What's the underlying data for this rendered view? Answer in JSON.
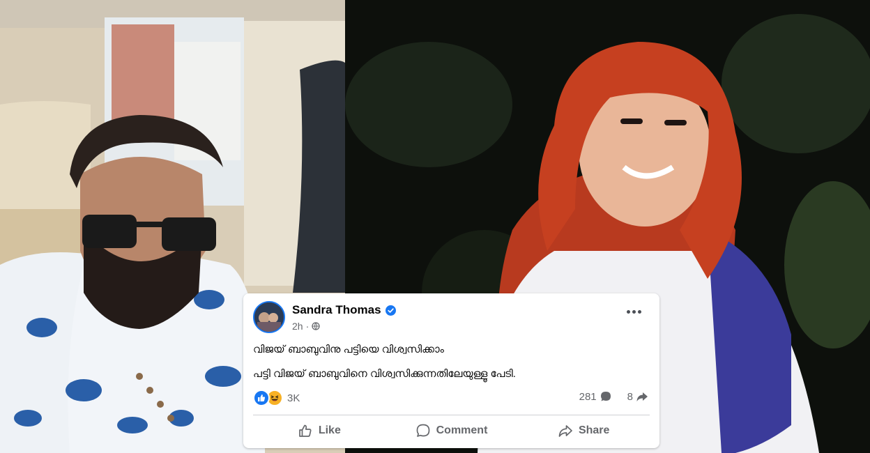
{
  "post": {
    "author": "Sandra Thomas",
    "time": "2h",
    "lines": [
      "വിജയ് ബാബുവിനു പട്ടിയെ വിശ്വസിക്കാം",
      "പട്ടി വിജയ് ബാബുവിനെ വിശ്വസിക്കുന്നതിലേയുള്ളൂ പേടി."
    ],
    "reactions": {
      "icons": [
        "like-icon",
        "haha-icon"
      ],
      "count": "3K"
    },
    "comments_count": "281",
    "shares_count": "8",
    "actions": {
      "like": "Like",
      "comment": "Comment",
      "share": "Share"
    }
  },
  "colors": {
    "facebook_blue": "#1877f2",
    "text_primary": "#050505",
    "text_secondary": "#65676b",
    "haha_yellow": "#f7b125"
  }
}
